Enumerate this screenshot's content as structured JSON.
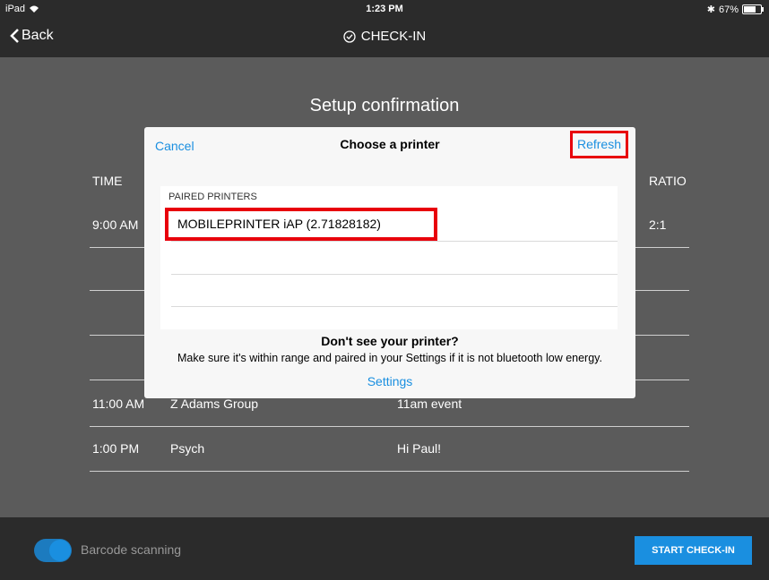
{
  "status": {
    "device": "iPad",
    "time": "1:23 PM",
    "battery": "67%"
  },
  "nav": {
    "back_label": "Back",
    "title": "CHECK-IN"
  },
  "page": {
    "heading": "Setup confirmation",
    "col_time": "TIME",
    "col_ratio": "RATIO"
  },
  "rows": [
    {
      "time": "9:00 AM",
      "group": "",
      "note": "",
      "ratio": "2:1"
    },
    {
      "time": "",
      "group": "",
      "note": "",
      "ratio": ""
    },
    {
      "time": "",
      "group": "",
      "note": "",
      "ratio": ""
    },
    {
      "time": "",
      "group": "",
      "note": "",
      "ratio": ""
    },
    {
      "time": "11:00 AM",
      "group": "Z Adams Group",
      "note": "11am event",
      "ratio": ""
    },
    {
      "time": "1:00 PM",
      "group": "Psych",
      "note": "Hi Paul!",
      "ratio": ""
    }
  ],
  "modal": {
    "cancel": "Cancel",
    "title": "Choose a printer",
    "refresh": "Refresh",
    "section_header": "PAIRED PRINTERS",
    "printers": [
      "MOBILEPRINTER iAP (2.71828182)"
    ],
    "help_title": "Don't see your printer?",
    "help_text": "Make sure it's within range and paired in your Settings if it is not bluetooth low energy.",
    "settings": "Settings"
  },
  "bottom": {
    "barcode_label": "Barcode scanning",
    "barcode_enabled": true,
    "start_button": "START CHECK-IN"
  },
  "colors": {
    "accent": "#1a8fe0",
    "highlight": "#e8000b",
    "bar": "#2b2b2b",
    "backdrop": "#5b5b5b"
  }
}
